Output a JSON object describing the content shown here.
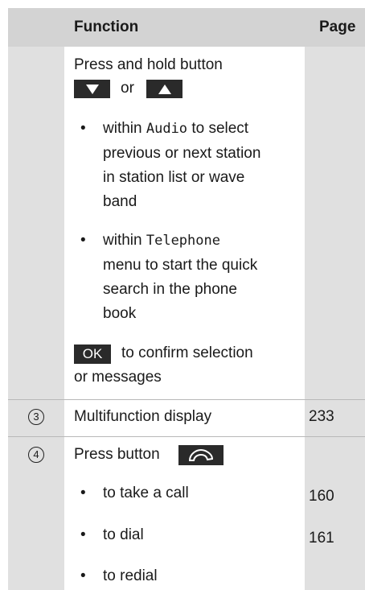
{
  "header": {
    "function": "Function",
    "page": "Page"
  },
  "block1": {
    "press_hold": "Press and hold button",
    "or": "or",
    "b1_l1_pre": "within ",
    "b1_l1_mono": "Audio",
    "b1_l1_post": " to select",
    "b1_l2": "previous or next station",
    "b1_l3": "in station list or wave",
    "b1_l4": "band",
    "b2_l1_pre": "within ",
    "b2_l1_mono": "Telephone",
    "b2_l2": "menu to start the quick",
    "b2_l3": "search in the phone",
    "b2_l4": "book",
    "ok_label": "OK",
    "ok_l1": "to confirm selection",
    "ok_l2": "or messages"
  },
  "row3": {
    "marker": "3",
    "text": "Multifunction display",
    "page": "233"
  },
  "row4": {
    "marker": "4",
    "press": "Press button",
    "b1": "to take a call",
    "p1": "160",
    "b2": "to dial",
    "p2": "161",
    "b3": "to redial"
  }
}
